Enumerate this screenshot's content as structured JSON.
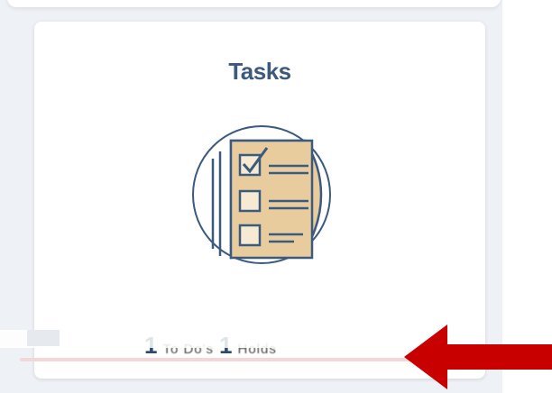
{
  "tile": {
    "title": "Tasks",
    "icon": "tasks-checklist-icon",
    "todo_count": "1",
    "todo_label": "To Do's",
    "holds_count": "1",
    "holds_label": "Holds"
  },
  "annotation": {
    "arrow_icon": "red-arrow-icon",
    "arrow_color": "#c80000"
  },
  "colors": {
    "title": "#3b5a7d",
    "icon_stroke": "#3b5a7d",
    "icon_fill": "#e8cc9e",
    "background": "#eef1f6"
  }
}
